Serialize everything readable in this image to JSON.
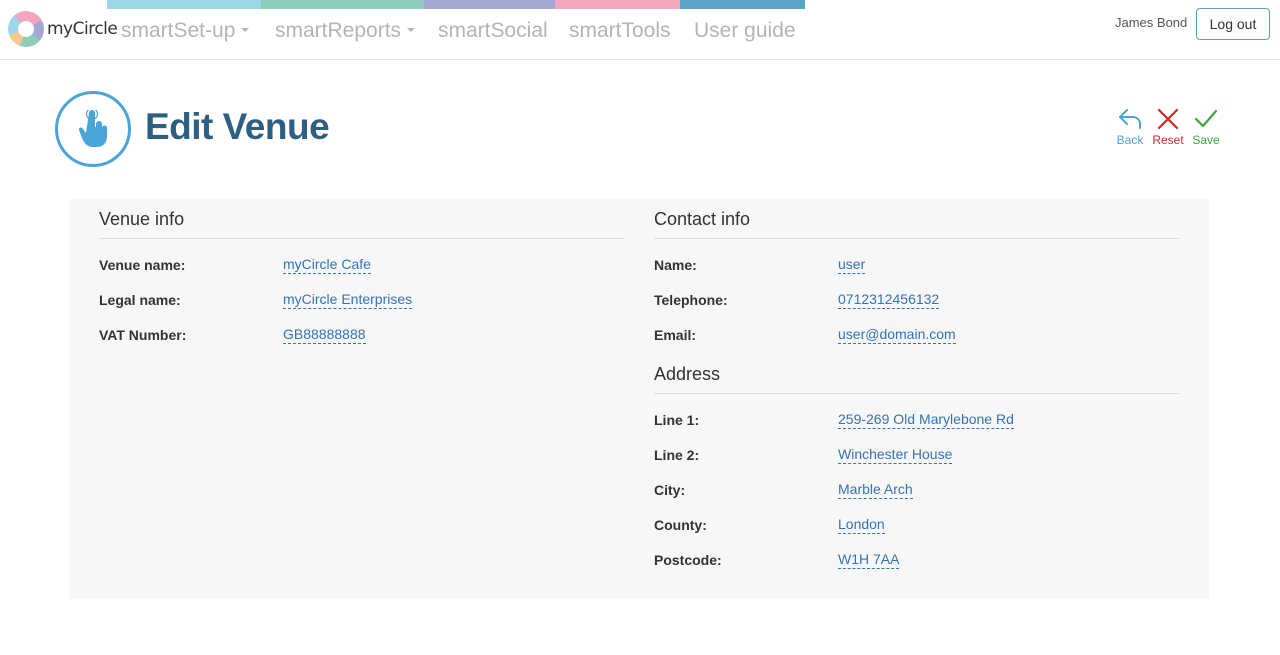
{
  "brand": {
    "name": "myCircle"
  },
  "nav": {
    "colors": [
      "#9fd6e8",
      "#8ecdb9",
      "#a6a8d4",
      "#f2a7bf",
      "#5aa5c5"
    ],
    "items": [
      {
        "label": "smartSet-up",
        "dropdown": true
      },
      {
        "label": "smartReports",
        "dropdown": true
      },
      {
        "label": "smartSocial",
        "dropdown": false
      },
      {
        "label": "smartTools",
        "dropdown": false
      },
      {
        "label": "User guide",
        "dropdown": false
      }
    ]
  },
  "user": {
    "name": "James Bond",
    "logout_label": "Log out"
  },
  "page": {
    "title": "Edit Venue",
    "icon": "hand-pointer-icon"
  },
  "actions": {
    "back": {
      "label": "Back",
      "icon": "undo-arrow-icon",
      "color": "#4aa4d8"
    },
    "reset": {
      "label": "Reset",
      "icon": "close-x-icon",
      "color": "#cc2a2a"
    },
    "save": {
      "label": "Save",
      "icon": "checkmark-icon",
      "color": "#3aa83a"
    }
  },
  "venue_info": {
    "title": "Venue info",
    "fields": [
      {
        "label": "Venue name:",
        "value": "myCircle Cafe"
      },
      {
        "label": "Legal name:",
        "value": "myCircle Enterprises"
      },
      {
        "label": "VAT Number:",
        "value": "GB88888888"
      }
    ]
  },
  "contact_info": {
    "title": "Contact info",
    "fields": [
      {
        "label": "Name:",
        "value": "user"
      },
      {
        "label": "Telephone:",
        "value": "0712312456132"
      },
      {
        "label": "Email:",
        "value": "user@domain.com"
      }
    ]
  },
  "address": {
    "title": "Address",
    "fields": [
      {
        "label": "Line 1:",
        "value": "259-269 Old Marylebone Rd"
      },
      {
        "label": "Line 2:",
        "value": "Winchester House"
      },
      {
        "label": "City:",
        "value": "Marble Arch"
      },
      {
        "label": "County:",
        "value": "London"
      },
      {
        "label": "Postcode:",
        "value": "W1H 7AA"
      }
    ]
  }
}
